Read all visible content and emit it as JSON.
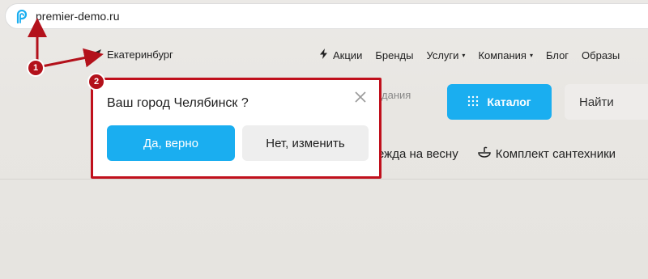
{
  "browser": {
    "url": "premier-demo.ru",
    "logo_icon": "premier-logo-icon"
  },
  "header": {
    "city": "Екатеринбург",
    "nav": [
      {
        "label": "Акции",
        "icon": "lightning-icon"
      },
      {
        "label": "Бренды"
      },
      {
        "label": "Услуги",
        "dropdown": true
      },
      {
        "label": "Компания",
        "dropdown": true
      },
      {
        "label": "Блог"
      },
      {
        "label": "Образы"
      }
    ],
    "partial_text": "дания",
    "catalog_label": "Каталог",
    "search_placeholder": "Найти",
    "promo_1": "ежда на весну",
    "promo_2": "Комплект сантехники"
  },
  "popup": {
    "question": "Ваш город Челябинск ?",
    "yes_label": "Да, верно",
    "no_label": "Нет, изменить"
  },
  "annotations": {
    "marker_1": "1",
    "marker_2": "2",
    "color": "#b3111b"
  },
  "colors": {
    "accent": "#1aaef0",
    "highlight": "#c0101c"
  }
}
